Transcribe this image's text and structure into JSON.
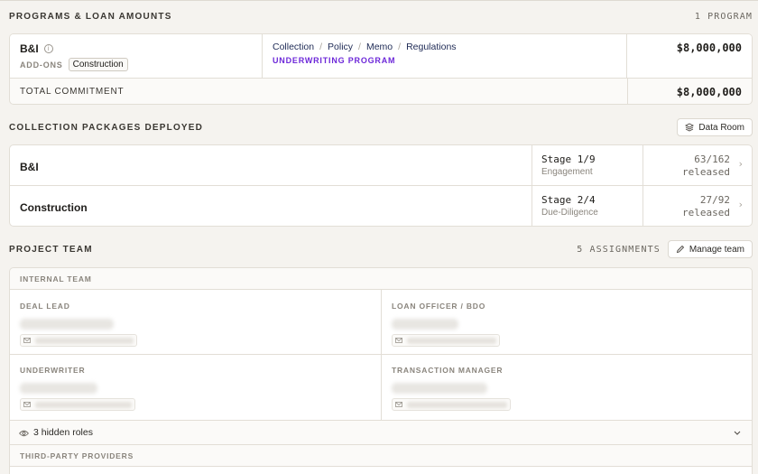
{
  "programs": {
    "title": "PROGRAMS & LOAN AMOUNTS",
    "count": "1 PROGRAM",
    "row": {
      "name": "B&I",
      "addons_label": "ADD-ONS",
      "addon_tag": "Construction",
      "links": [
        "Collection",
        "Policy",
        "Memo",
        "Regulations"
      ],
      "separator": "/",
      "subtitle": "UNDERWRITING PROGRAM",
      "amount": "$8,000,000"
    },
    "total_label": "TOTAL COMMITMENT",
    "total_amount": "$8,000,000"
  },
  "collections": {
    "title": "COLLECTION PACKAGES DEPLOYED",
    "data_room_label": "Data Room",
    "rows": [
      {
        "name": "B&I",
        "stage": "Stage 1/9",
        "stage_name": "Engagement",
        "released_count": "63/162",
        "released_label": "released"
      },
      {
        "name": "Construction",
        "stage": "Stage 2/4",
        "stage_name": "Due-Diligence",
        "released_count": "27/92",
        "released_label": "released"
      }
    ]
  },
  "team": {
    "title": "PROJECT TEAM",
    "count": "5 ASSIGNMENTS",
    "manage_label": "Manage team",
    "internal_label": "INTERNAL TEAM",
    "roles": [
      "DEAL LEAD",
      "LOAN OFFICER / BDO",
      "UNDERWRITER",
      "TRANSACTION MANAGER"
    ],
    "hidden_roles": "3 hidden roles",
    "third_party_label": "THIRD-PARTY PROVIDERS"
  },
  "colors": {
    "accent_purple": "#6d28d9",
    "background": "#f5f3ef",
    "border": "#e2ded6"
  }
}
